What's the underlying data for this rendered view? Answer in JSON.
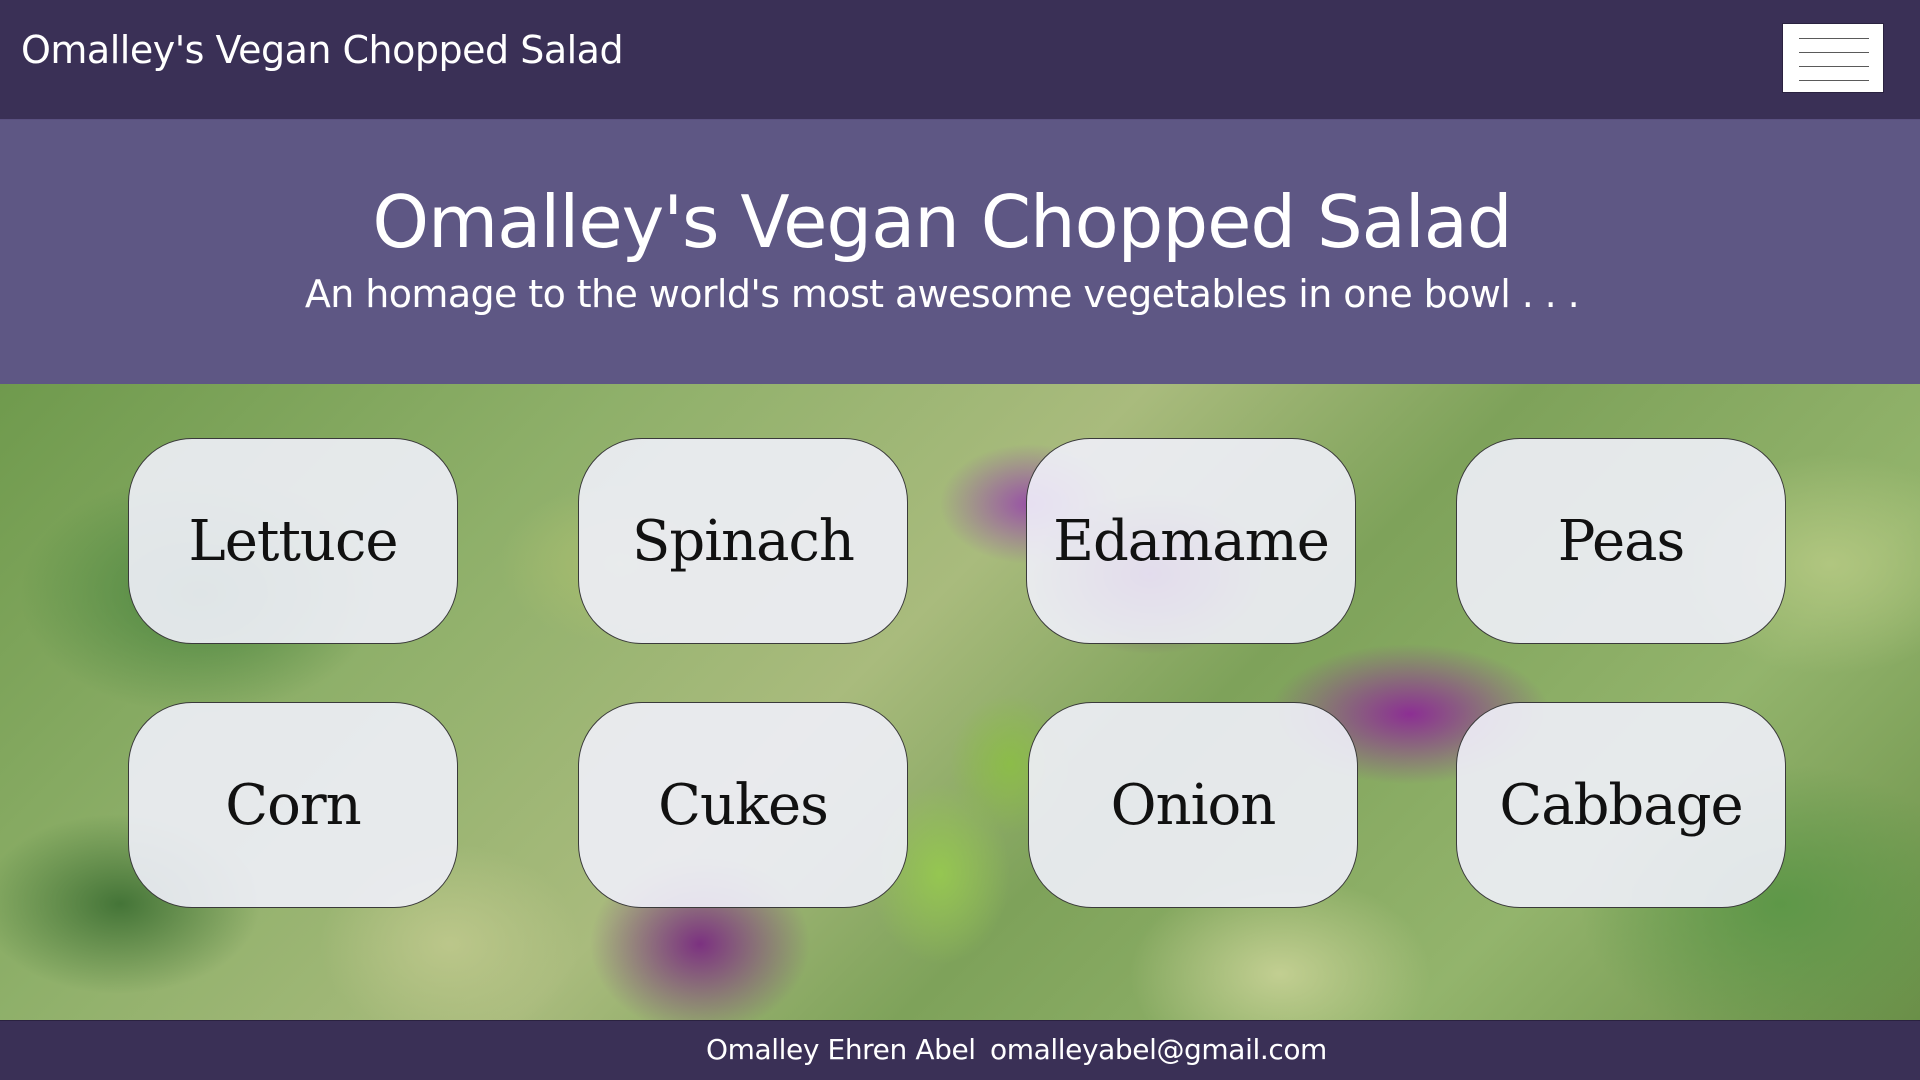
{
  "navbar": {
    "brand": "Omalley's Vegan Chopped Salad",
    "menu_icon": "hamburger-menu-icon"
  },
  "hero": {
    "title": "Omalley's Vegan Chopped Salad",
    "subtitle": "An homage to the world's most awesome vegetables in one bowl . . ."
  },
  "vegetables": [
    {
      "label": "Lettuce"
    },
    {
      "label": "Spinach"
    },
    {
      "label": "Edamame"
    },
    {
      "label": "Peas"
    },
    {
      "label": "Corn"
    },
    {
      "label": "Cukes"
    },
    {
      "label": "Onion"
    },
    {
      "label": "Cabbage"
    }
  ],
  "footer": {
    "name": "Omalley Ehren Abel",
    "email": "omalleyabel@gmail.com"
  },
  "colors": {
    "navbar": "#3a3056",
    "hero": "#5e5784",
    "button_fill": "#f0f0fa"
  }
}
